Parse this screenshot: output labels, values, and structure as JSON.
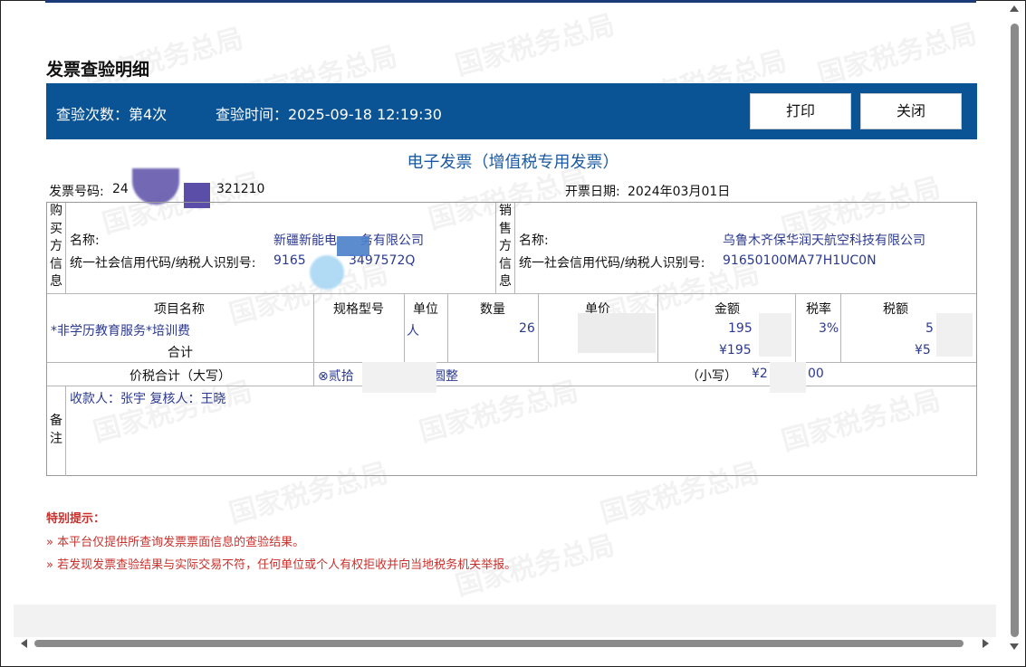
{
  "page": {
    "title": "发票查验明细",
    "watermark": "国家税务总局"
  },
  "toolbar": {
    "check_count": "查验次数：第4次",
    "check_time": "查验时间：2025-09-18 12:19:30",
    "print_label": "打印",
    "close_label": "关闭"
  },
  "invoice": {
    "type_title": "电子发票（增值税专用发票）",
    "number_label": "发票号码:",
    "number_start": "24",
    "number_end": "321210",
    "date_label": "开票日期:",
    "date_value": "2024年03月01日",
    "buyer": {
      "section": [
        "购",
        "买",
        "方",
        "信",
        "息"
      ],
      "name_label": "名称:",
      "name_value_a": "新疆新能电",
      "name_value_b": "务有限公司",
      "tax_label": "统一社会信用代码/纳税人识别号:",
      "tax_value_a": "9165",
      "tax_value_b": "3497572Q"
    },
    "seller": {
      "section": [
        "销",
        "售",
        "方",
        "信",
        "息"
      ],
      "name_label": "名称:",
      "name_value": "乌鲁木齐保华润天航空科技有限公司",
      "tax_label": "统一社会信用代码/纳税人识别号:",
      "tax_value": "91650100MA77H1UC0N"
    },
    "items_header": {
      "name": "项目名称",
      "spec": "规格型号",
      "unit": "单位",
      "qty": "数量",
      "price": "单价",
      "amount": "金额",
      "rate": "税率",
      "tax": "税额"
    },
    "item": {
      "name": "*非学历教育服务*培训费",
      "unit": "人",
      "qty": "26",
      "amount": "195",
      "rate": "3%",
      "tax": "5"
    },
    "total": {
      "label": "合计",
      "amount": "¥195",
      "tax": "¥5"
    },
    "grand_total": {
      "label": "价税合计（大写）",
      "upper_a": "⊗贰拾",
      "upper_b": "贰圆整",
      "small_label": "（小写）",
      "small_a": "¥2",
      "small_b": "00"
    },
    "remarks": {
      "section": [
        "备",
        "注"
      ],
      "text": "收款人：张宇  复核人：王晓"
    }
  },
  "tips": {
    "title": "特别提示：",
    "items": [
      "»  本平台仅提供所查询发票票面信息的查验结果。",
      "»  若发现发票查验结果与实际交易不符，任何单位或个人有权拒收并向当地税务机关举报。"
    ]
  }
}
